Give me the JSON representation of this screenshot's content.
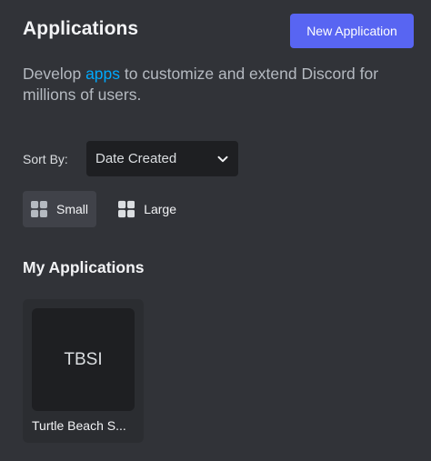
{
  "header": {
    "title": "Applications",
    "new_button_label": "New Application"
  },
  "intro": {
    "before_link": "Develop ",
    "link_text": "apps",
    "after_link": " to customize and extend Discord for millions of users."
  },
  "sort": {
    "label": "Sort By:",
    "selected": "Date Created",
    "icon": "chevron-down-icon"
  },
  "view_size": {
    "options": [
      {
        "label": "Small",
        "icon": "grid-icon",
        "selected": true
      },
      {
        "label": "Large",
        "icon": "grid-icon",
        "selected": false
      }
    ]
  },
  "my_apps": {
    "title": "My Applications",
    "items": [
      {
        "thumb_text": "TBSI",
        "name": "Turtle Beach S..."
      }
    ]
  },
  "colors": {
    "background": "#313338",
    "primary_button": "#5865f2",
    "link": "#00a8fc",
    "select_bg": "#1e1f22",
    "selected_toggle_bg": "#404249",
    "card_bg": "#2b2d31",
    "text": "#f2f3f5",
    "muted_text": "#b5bac1"
  }
}
